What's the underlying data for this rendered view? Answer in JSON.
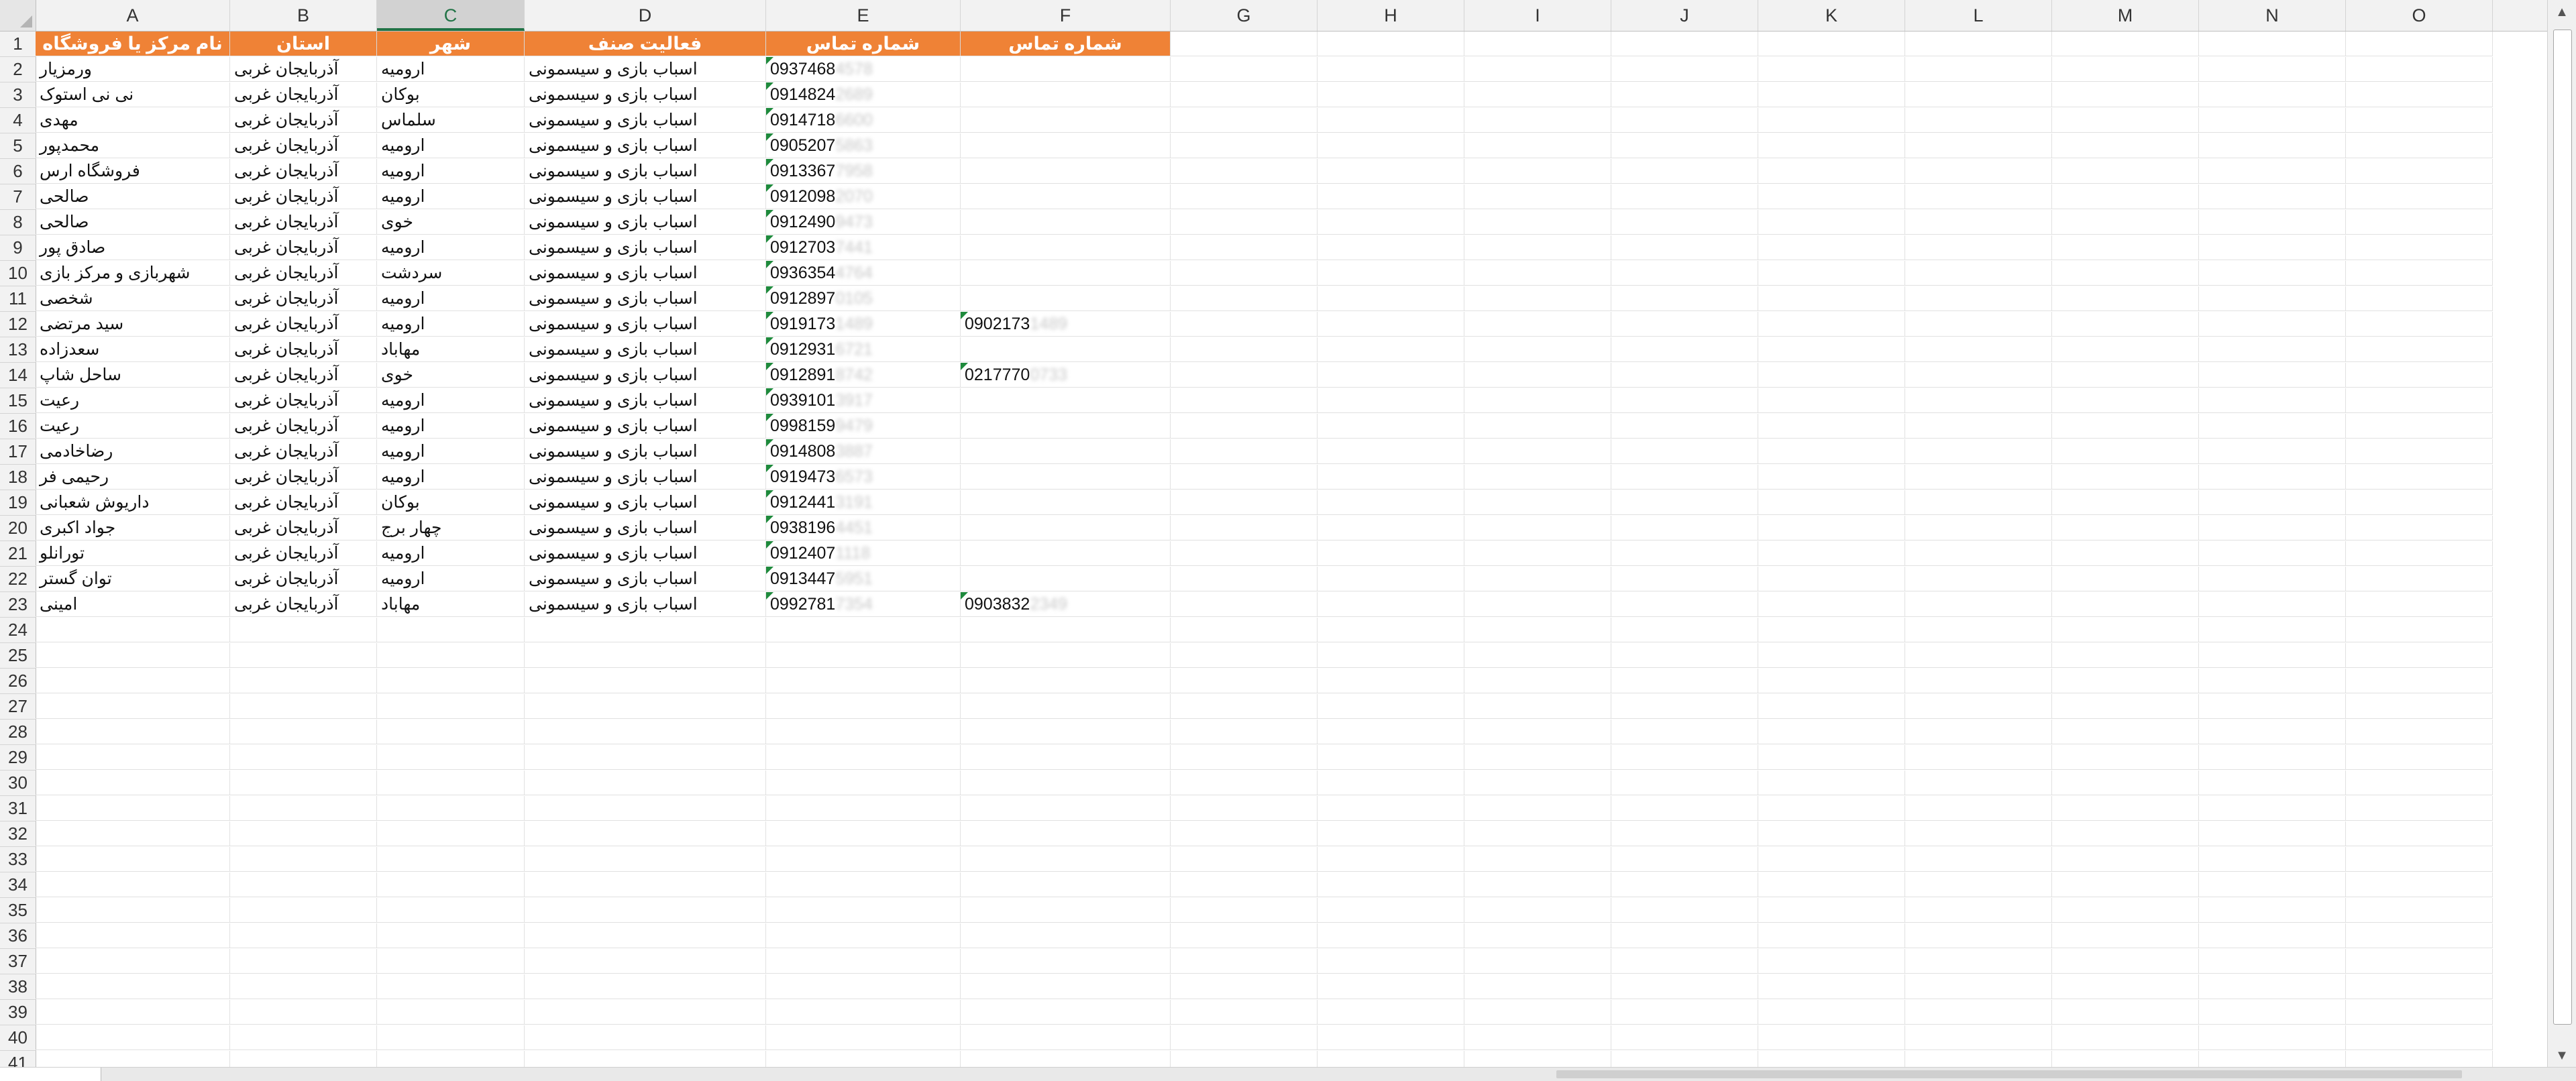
{
  "columns": [
    "A",
    "B",
    "C",
    "D",
    "E",
    "F",
    "G",
    "H",
    "I",
    "J",
    "K",
    "L",
    "M",
    "N",
    "O"
  ],
  "selected_column": "C",
  "header_row": {
    "store_name": "نام مرکز یا فروشگاه",
    "province": "استان",
    "city": "شهر",
    "activity": "فعالیت صنف",
    "phone1": "شماره تماس",
    "phone2": "شماره تماس"
  },
  "rows": [
    {
      "store_name": "ورمزیار",
      "province": "آذربایجان غربی",
      "city": "ارومیه",
      "activity": "اسباب بازی و سیسمونی",
      "phone1": "0937468",
      "phone1_tail": "4578",
      "phone2": "",
      "phone2_tail": ""
    },
    {
      "store_name": "نی نی استوک",
      "province": "آذربایجان غربی",
      "city": "بوکان",
      "activity": "اسباب بازی و سیسمونی",
      "phone1": "0914824",
      "phone1_tail": "2689",
      "phone2": "",
      "phone2_tail": ""
    },
    {
      "store_name": "مهدی",
      "province": "آذربایجان غربی",
      "city": "سلماس",
      "activity": "اسباب بازی و سیسمونی",
      "phone1": "0914718",
      "phone1_tail": "6600",
      "phone2": "",
      "phone2_tail": ""
    },
    {
      "store_name": "محمدپور",
      "province": "آذربایجان غربی",
      "city": "ارومیه",
      "activity": "اسباب بازی و سیسمونی",
      "phone1": "0905207",
      "phone1_tail": "5863",
      "phone2": "",
      "phone2_tail": ""
    },
    {
      "store_name": "فروشگاه ارس",
      "province": "آذربایجان غربی",
      "city": "ارومیه",
      "activity": "اسباب بازی و سیسمونی",
      "phone1": "0913367",
      "phone1_tail": "7958",
      "phone2": "",
      "phone2_tail": ""
    },
    {
      "store_name": "صالحی",
      "province": "آذربایجان غربی",
      "city": "ارومیه",
      "activity": "اسباب بازی و سیسمونی",
      "phone1": "0912098",
      "phone1_tail": "2070",
      "phone2": "",
      "phone2_tail": ""
    },
    {
      "store_name": "صالحی",
      "province": "آذربایجان غربی",
      "city": "خوی",
      "activity": "اسباب بازی و سیسمونی",
      "phone1": "0912490",
      "phone1_tail": "9473",
      "phone2": "",
      "phone2_tail": ""
    },
    {
      "store_name": "صادق پور",
      "province": "آذربایجان غربی",
      "city": "ارومیه",
      "activity": "اسباب بازی و سیسمونی",
      "phone1": "0912703",
      "phone1_tail": "7441",
      "phone2": "",
      "phone2_tail": ""
    },
    {
      "store_name": "شهربازی و مرکز بازی",
      "province": "آذربایجان غربی",
      "city": "سردشت",
      "activity": "اسباب بازی و سیسمونی",
      "phone1": "0936354",
      "phone1_tail": "4764",
      "phone2": "",
      "phone2_tail": ""
    },
    {
      "store_name": "شخصی",
      "province": "آذربایجان غربی",
      "city": "ارومیه",
      "activity": "اسباب بازی و سیسمونی",
      "phone1": "0912897",
      "phone1_tail": "0105",
      "phone2": "",
      "phone2_tail": ""
    },
    {
      "store_name": "سید مرتضی",
      "province": "آذربایجان غربی",
      "city": "ارومیه",
      "activity": "اسباب بازی و سیسمونی",
      "phone1": "0919173",
      "phone1_tail": "1489",
      "phone2": "0902173",
      "phone2_tail": "1489"
    },
    {
      "store_name": "سعدزاده",
      "province": "آذربایجان غربی",
      "city": "مهاباد",
      "activity": "اسباب بازی و سیسمونی",
      "phone1": "0912931",
      "phone1_tail": "6721",
      "phone2": "",
      "phone2_tail": ""
    },
    {
      "store_name": "ساحل شاپ",
      "province": "آذربایجان غربی",
      "city": "خوی",
      "activity": "اسباب بازی و سیسمونی",
      "phone1": "0912891",
      "phone1_tail": "8742",
      "phone2": "0217770",
      "phone2_tail": "0733"
    },
    {
      "store_name": "رعیت",
      "province": "آذربایجان غربی",
      "city": "ارومیه",
      "activity": "اسباب بازی و سیسمونی",
      "phone1": "0939101",
      "phone1_tail": "3917",
      "phone2": "",
      "phone2_tail": ""
    },
    {
      "store_name": "رعیت",
      "province": "آذربایجان غربی",
      "city": "ارومیه",
      "activity": "اسباب بازی و سیسمونی",
      "phone1": "0998159",
      "phone1_tail": "9479",
      "phone2": "",
      "phone2_tail": ""
    },
    {
      "store_name": "رضاخادمی",
      "province": "آذربایجان غربی",
      "city": "ارومیه",
      "activity": "اسباب بازی و سیسمونی",
      "phone1": "0914808",
      "phone1_tail": "3887",
      "phone2": "",
      "phone2_tail": ""
    },
    {
      "store_name": "رحیمی فر",
      "province": "آذربایجان غربی",
      "city": "ارومیه",
      "activity": "اسباب بازی و سیسمونی",
      "phone1": "0919473",
      "phone1_tail": "6573",
      "phone2": "",
      "phone2_tail": ""
    },
    {
      "store_name": "داریوش شعبانی",
      "province": "آذربایجان غربی",
      "city": "بوکان",
      "activity": "اسباب بازی و سیسمونی",
      "phone1": "0912441",
      "phone1_tail": "3191",
      "phone2": "",
      "phone2_tail": ""
    },
    {
      "store_name": "جواد اکبری",
      "province": "آذربایجان غربی",
      "city": "چهار برج",
      "activity": "اسباب بازی و سیسمونی",
      "phone1": "0938196",
      "phone1_tail": "4451",
      "phone2": "",
      "phone2_tail": ""
    },
    {
      "store_name": "تورانلو",
      "province": "آذربایجان غربی",
      "city": "ارومیه",
      "activity": "اسباب بازی و سیسمونی",
      "phone1": "0912407",
      "phone1_tail": "1118",
      "phone2": "",
      "phone2_tail": ""
    },
    {
      "store_name": "توان گستر",
      "province": "آذربایجان غربی",
      "city": "ارومیه",
      "activity": "اسباب بازی و سیسمونی",
      "phone1": "0913447",
      "phone1_tail": "5951",
      "phone2": "",
      "phone2_tail": ""
    },
    {
      "store_name": "امینی",
      "province": "آذربایجان غربی",
      "city": "مهاباد",
      "activity": "اسباب بازی و سیسمونی",
      "phone1": "0992781",
      "phone1_tail": "7354",
      "phone2": "0903832",
      "phone2_tail": "2349"
    }
  ],
  "empty_row_numbers": [
    "24",
    "25",
    "26",
    "27",
    "28",
    "29",
    "30",
    "31",
    "32",
    "33",
    "34",
    "35",
    "36",
    "37",
    "38",
    "39",
    "40",
    "41"
  ],
  "colors": {
    "header_fill": "#ef8236",
    "header_text": "#ffffff",
    "comment_flag": "#1e8a3c",
    "selected_col": "#217346"
  }
}
